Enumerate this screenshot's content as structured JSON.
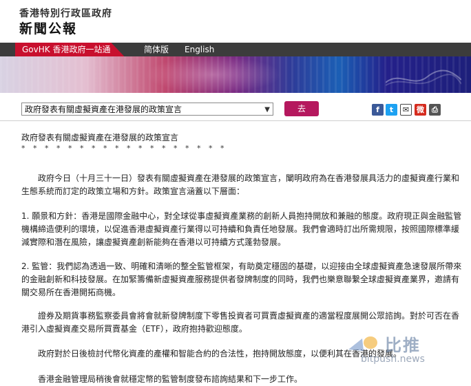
{
  "header": {
    "site_name": "香港特別行政區政府",
    "section_name": "新聞公報"
  },
  "nav": {
    "govhk": "GovHK 香港政府一站通",
    "simplified": "简体版",
    "english": "English"
  },
  "toolbar": {
    "selected_release": "政府發表有關虛擬資產在港發展的政策宣言",
    "go_label": "去"
  },
  "share": {
    "facebook": "f",
    "twitter": "t",
    "email": "✉",
    "weibo": "微",
    "print": "⎙"
  },
  "article": {
    "title": "政府發表有關虛擬資產在港發展的政策宣言",
    "stars": "* * * * * * * * * * * * * * * * * *",
    "p1": "　　政府今日（十月三十一日）發表有關虛擬資產在港發展的政策宣言，闡明政府為在香港發展具活力的虛擬資產行業和生態系統而訂定的政策立場和方針。政策宣言涵蓋以下層面：",
    "p2": "1. 願景和方針：香港是國際金融中心，對全球從事虛擬資產業務的創新人員抱持開放和兼融的態度。政府現正與金融監管機構締造便利的環境，以促進香港虛擬資產行業得以可持續和負責任地發展。我們會適時訂出所需規限，按照國際標準緩減實際和潛在風險，讓虛擬資產創新能夠在香港以可持續方式蓬勃發展。",
    "p3": "2. 監管：我們認為透過一致、明確和清晰的整全監管框架，有助奠定穩固的基礎，以迎接由全球虛擬資產急速發展所帶來的金融創新和科技發展。在加緊籌備新虛擬資產服務提供者發牌制度的同時，我們也樂意聯繫全球虛擬資產業界，邀請有關交易所在香港開拓商機。",
    "p4": "　　證券及期貨事務監察委員會將會就新發牌制度下零售投資者可買賣虛擬資產的適當程度展開公眾諮詢。對於可否在香港引入虛擬資產交易所買賣基金（ETF），政府抱持歡迎態度。",
    "p5": "　　政府對於日後檢討代幣化資產的產權和智能合約的合法性，抱持開放態度，以便利其在香港的發展。",
    "p6": "　　香港金融管理局稍後會就穩定幣的監管制度發布諮詢結果和下一步工作。"
  },
  "watermark": {
    "brand": "比推",
    "url": "bitpush.news"
  },
  "colors": {
    "govhk_red": "#c8102e",
    "go_button": "#b5185e",
    "facebook": "#3b5998",
    "twitter": "#1da1f2",
    "weibo": "#d52b1e"
  }
}
